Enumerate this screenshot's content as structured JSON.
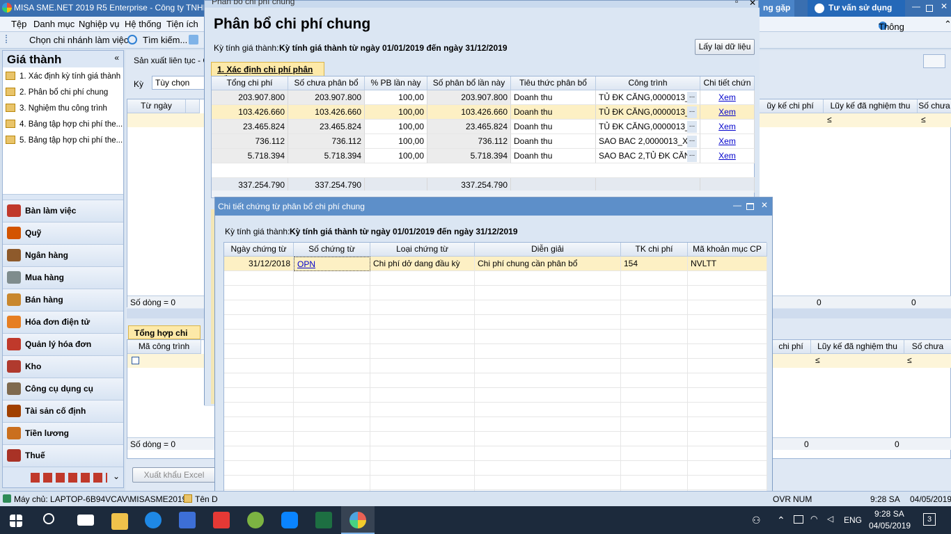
{
  "app": {
    "title": "MISA SME.NET 2019 R5 Enterprise - Công ty TNHH",
    "help_btn": "ng gặp",
    "advisor_btn": "Tư vấn sử dụng",
    "notify": "Thông báo"
  },
  "menu": [
    "Tệp",
    "Danh mục",
    "Nghiệp vụ",
    "Hệ thống",
    "Tiện ích"
  ],
  "toolbar": {
    "branch": "Chọn chi nhánh làm việc",
    "search": "Tìm kiếm..."
  },
  "left": {
    "title": "Giá thành",
    "items": [
      "1. Xác định kỳ tính giá thành",
      "2. Phân bổ chi phí chung",
      "3. Nghiệm thu công trình",
      "4. Bảng tập hợp chi phí the...",
      "5. Bảng tập hợp chi phí the..."
    ],
    "nav": [
      {
        "label": "Bàn làm việc",
        "color": "#c0392b"
      },
      {
        "label": "Quỹ",
        "color": "#d35400"
      },
      {
        "label": "Ngân hàng",
        "color": "#8e5a2b"
      },
      {
        "label": "Mua hàng",
        "color": "#7f8c8d"
      },
      {
        "label": "Bán hàng",
        "color": "#c8872e"
      },
      {
        "label": "Hóa đơn điện tử",
        "color": "#e67e22"
      },
      {
        "label": "Quản lý hóa đơn",
        "color": "#c0392b"
      },
      {
        "label": "Kho",
        "color": "#b03a2e"
      },
      {
        "label": "Công cụ dụng cụ",
        "color": "#7f6a4f"
      },
      {
        "label": "Tài sản cố định",
        "color": "#a04000"
      },
      {
        "label": "Tiền lương",
        "color": "#ca6f1e"
      },
      {
        "label": "Thuế",
        "color": "#a93226"
      }
    ]
  },
  "back": {
    "breadcrumb": "Sản xuất liên tục - Gi",
    "ky_label": "Kỳ",
    "ky_value": "Tùy chọn",
    "col_tungay": "Từ ngày",
    "col_luyke_cp": "ũy kế chi phí",
    "col_luyke_nt": "Lũy kế đã nghiệm thu",
    "col_sochua": "Số chưa",
    "so_dong": "Số dòng = 0",
    "zero": "0",
    "tong_hop_tab": "Tổng hợp chi phí",
    "col_ma_ct": "Mã công trình",
    "col_cp2": "chi phí",
    "col_luyke_nt2": "Lũy kế đã nghiệm thu",
    "col_sochua2": "Số chưa ngh",
    "xuat_khau": "Xuất khẩu Excel",
    "le": "≤"
  },
  "pb": {
    "wintitle": "Phân bổ chi phí chung",
    "title": "Phân bổ chi phí chung",
    "ky_label": "Kỳ tính giá thành:",
    "ky_value": "Kỳ tính giá thành từ ngày 01/01/2019 đến ngày 31/12/2019",
    "reload": "Lấy lại dữ liệu",
    "tab": "1. Xác định chi phí phân bổ",
    "cols": [
      "Tổng chi phí",
      "Số chưa phân bổ",
      "% PB lần này",
      "Số phân bổ lần này",
      "Tiêu thức phân bổ",
      "Công trình",
      "Chi tiết chứn"
    ],
    "rows": [
      [
        "203.907.800",
        "203.907.800",
        "100,00",
        "203.907.800",
        "Doanh thu",
        "TỦ ĐK CĂNG,0000013_",
        "Xem"
      ],
      [
        "103.426.660",
        "103.426.660",
        "100,00",
        "103.426.660",
        "Doanh thu",
        "TỦ ĐK CĂNG,0000013_",
        "Xem"
      ],
      [
        "23.465.824",
        "23.465.824",
        "100,00",
        "23.465.824",
        "Doanh thu",
        "TỦ ĐK CĂNG,0000013_",
        "Xem"
      ],
      [
        "736.112",
        "736.112",
        "100,00",
        "736.112",
        "Doanh thu",
        "SAO BAC 2,0000013_X",
        "Xem"
      ],
      [
        "5.718.394",
        "5.718.394",
        "100,00",
        "5.718.394",
        "Doanh thu",
        "SAO BAC 2,TỦ ĐK CĂN",
        "Xem"
      ]
    ],
    "totals": [
      "337.254.790",
      "337.254.790",
      "",
      "337.254.790"
    ]
  },
  "ct": {
    "title": "Chi tiết chứng từ phân bổ chi phí chung",
    "ky_label": "Kỳ tính giá thành:",
    "ky_value": "Kỳ tính giá thành từ ngày 01/01/2019 đến ngày 31/12/2019",
    "cols": [
      "Ngày chứng từ",
      "Số chứng từ",
      "Loại chứng từ",
      "Diễn giải",
      "TK chi phí",
      "Mã khoản mục CP"
    ],
    "rows": [
      [
        "31/12/2018",
        "OPN",
        "Chi phí dở dang đầu kỳ",
        "Chi phí chung cần phân bổ",
        "154",
        "NVLTT"
      ]
    ]
  },
  "status": {
    "server": "Máy chủ: LAPTOP-6B94VCAV\\MISASME2019",
    "ten": "Tên D",
    "ovr": "OVR",
    "num": "NUM",
    "time": "9:28 SA",
    "date": "04/05/2019"
  },
  "taskbar": {
    "lang": "ENG",
    "time": "9:28 SA",
    "date": "04/05/2019",
    "badge": "3"
  }
}
